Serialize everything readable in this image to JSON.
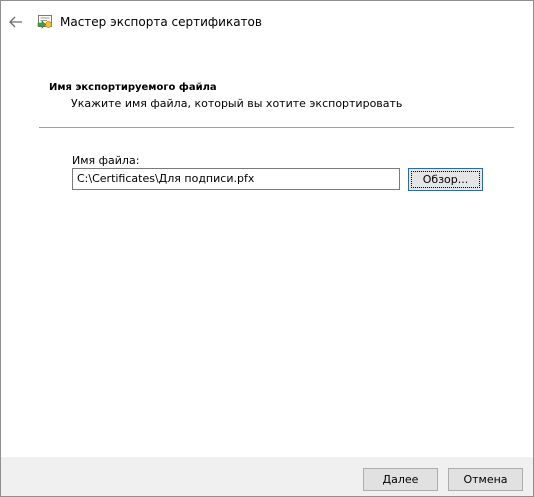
{
  "wizard": {
    "title": "Мастер экспорта сертификатов",
    "back_icon": "back-arrow-icon",
    "wizard_icon": "certificate-icon"
  },
  "section": {
    "heading": "Имя экспортируемого файла",
    "subheading": "Укажите имя файла, который вы хотите экспортировать"
  },
  "file": {
    "label": "Имя файла:",
    "value": "C:\\Certificates\\Для подписи.pfx",
    "browse_label": "Обзор..."
  },
  "footer": {
    "next_label": "Далее",
    "cancel_label": "Отмена"
  },
  "colors": {
    "focus_border": "#0078d7",
    "footer_background": "#f0f0f0"
  }
}
